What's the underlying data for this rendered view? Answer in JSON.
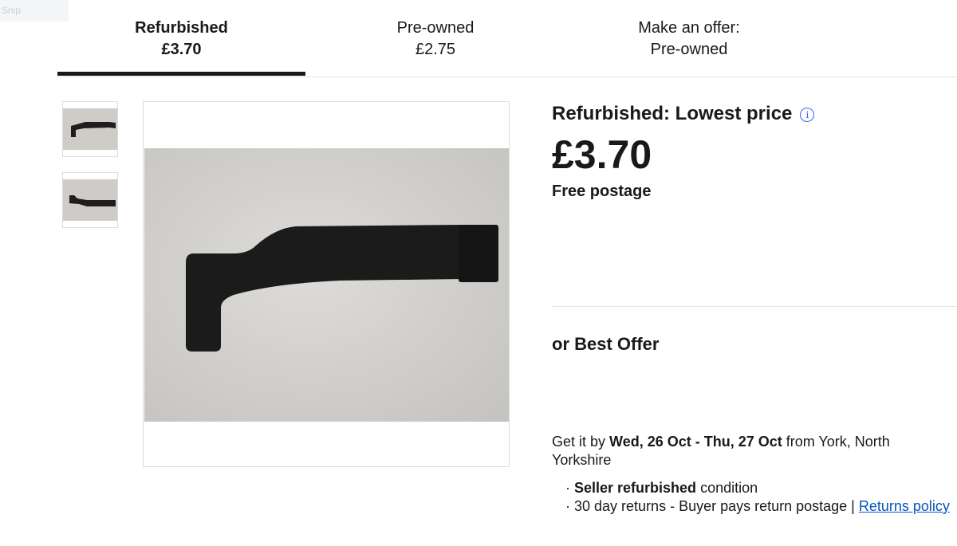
{
  "overlay": {
    "snip_label": "Snip"
  },
  "tabs": [
    {
      "line1": "Refurbished",
      "line2": "£3.70",
      "selected": true
    },
    {
      "line1": "Pre-owned",
      "line2": "£2.75",
      "selected": false
    },
    {
      "line1": "Make an offer:",
      "line2": "Pre-owned",
      "selected": false
    }
  ],
  "gallery": {
    "thumbnails": [
      "black-ribbon-cable-photo-1",
      "black-ribbon-cable-photo-2"
    ],
    "main_image": "black-ribbon-cable-photo"
  },
  "offer": {
    "heading": "Refurbished: Lowest price",
    "info_icon": "info-icon",
    "price": "£3.70",
    "postage": "Free postage",
    "best_offer": "or Best Offer"
  },
  "delivery": {
    "prefix": "Get it by ",
    "dates": "Wed, 26 Oct - Thu, 27 Oct",
    "suffix": " from York, North Yorkshire"
  },
  "bullets": {
    "b1_bold": "Seller refurbished",
    "b1_rest": " condition",
    "b2_text": "30 day returns - Buyer pays return postage | ",
    "b2_link": "Returns policy"
  },
  "colors": {
    "accent_blue": "#3665f3",
    "link_blue": "#0654ba",
    "text": "#191919",
    "divider": "#e5e5e5"
  }
}
